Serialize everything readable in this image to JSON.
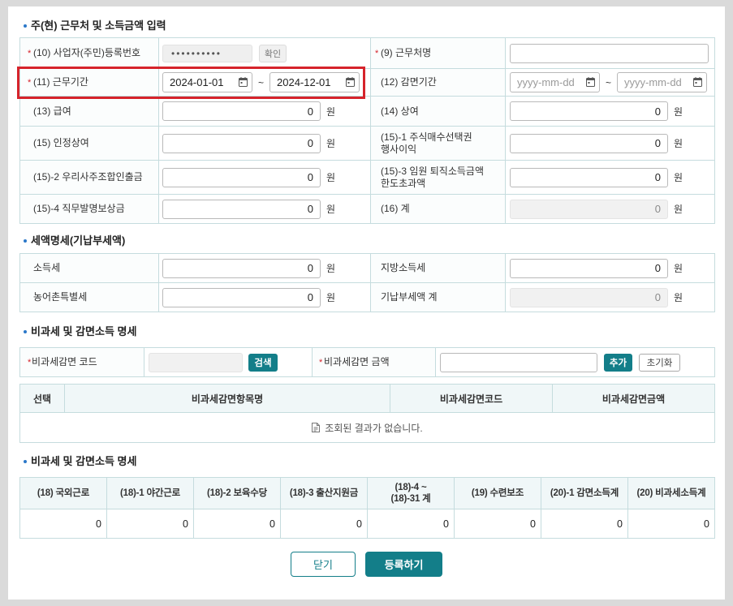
{
  "colors": {
    "accent": "#137e89",
    "required": "#d6232b",
    "highlight": "#d6232b",
    "bullet": "#2b78c9",
    "border": "#c5dcde"
  },
  "currency_unit": "원",
  "income_section": {
    "title": "주(현) 근무처 및 소득금액 입력",
    "business_reg_no": {
      "required": "*",
      "label": "(10) 사업자(주민)등록번호",
      "value": "••••••••••",
      "confirm_button": "확인"
    },
    "workplace_name": {
      "required": "*",
      "label": "(9) 근무처명",
      "value": ""
    },
    "work_period": {
      "required": "*",
      "label": "(11) 근무기간",
      "start": "2024-01-01",
      "separator": "~",
      "end": "2024-12-01"
    },
    "reduction_period": {
      "label": "(12) 감면기간",
      "start_placeholder": "yyyy-mm-dd",
      "separator": "~",
      "end_placeholder": "yyyy-mm-dd"
    },
    "salary": {
      "label": "(13) 급여",
      "value": "0"
    },
    "bonus": {
      "label": "(14) 상여",
      "value": "0"
    },
    "recognized_bonus": {
      "label": "(15) 인정상여",
      "value": "0"
    },
    "stock_option_gain": {
      "label": [
        "(15)-1 주식매수선택권",
        "행사이익"
      ],
      "value": "0"
    },
    "employee_stock_withdrawal": {
      "label": "(15)-2 우리사주조합인출금",
      "value": "0"
    },
    "executive_retirement_excess": {
      "label": [
        "(15)-3 임원 퇴직소득금액",
        "한도초과액"
      ],
      "value": "0"
    },
    "invention_reward": {
      "label": "(15)-4 직무발명보상금",
      "value": "0"
    },
    "total": {
      "label": "(16) 계",
      "value": "0"
    }
  },
  "tax_section": {
    "title": "세액명세(기납부세액)",
    "income_tax": {
      "label": "소득세",
      "value": "0"
    },
    "local_income_tax": {
      "label": "지방소득세",
      "value": "0"
    },
    "rural_special_tax": {
      "label": "농어촌특별세",
      "value": "0"
    },
    "prepaid_total": {
      "label": "기납부세액 계",
      "value": "0"
    }
  },
  "nontax_section": {
    "title": "비과세 및 감면소득 명세",
    "code": {
      "required": "*",
      "label": "비과세감면 코드",
      "value": "",
      "search_button": "검색"
    },
    "amount": {
      "required": "*",
      "label": "비과세감면 금액",
      "value": "",
      "add_button": "추가",
      "reset_button": "초기화"
    },
    "list": {
      "headers": [
        "선택",
        "비과세감면항목명",
        "비과세감면코드",
        "비과세감면금액"
      ],
      "empty_message": "조회된 결과가 없습니다."
    }
  },
  "nontax_summary": {
    "title": "비과세 및 감면소득 명세",
    "headers": [
      [
        "(18) 국외근로"
      ],
      [
        "(18)-1 야간근로"
      ],
      [
        "(18)-2 보육수당"
      ],
      [
        "(18)-3 출산지원금"
      ],
      [
        "(18)-4 ~",
        "(18)-31 계"
      ],
      [
        "(19) 수련보조"
      ],
      [
        "(20)-1 감면소득계"
      ],
      [
        "(20) 비과세소득계"
      ]
    ],
    "values": [
      "0",
      "0",
      "0",
      "0",
      "0",
      "0",
      "0",
      "0"
    ]
  },
  "footer": {
    "close_button": "닫기",
    "submit_button": "등록하기"
  }
}
